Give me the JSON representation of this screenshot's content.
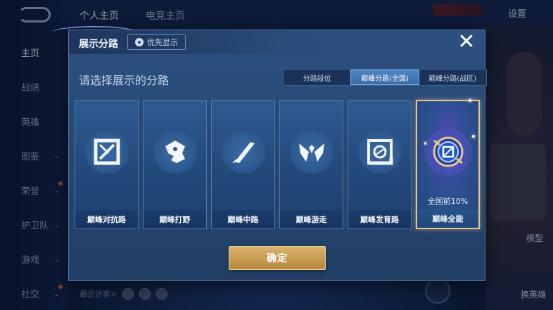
{
  "nav": {
    "items": [
      {
        "label": "主页",
        "active": true,
        "chevron": false,
        "dot": false
      },
      {
        "label": "战绩",
        "active": false,
        "chevron": false,
        "dot": false
      },
      {
        "label": "英雄",
        "active": false,
        "chevron": false,
        "dot": false
      },
      {
        "label": "图鉴",
        "active": false,
        "chevron": true,
        "dot": false
      },
      {
        "label": "荣誉",
        "active": false,
        "chevron": true,
        "dot": true
      },
      {
        "label": "护卫队",
        "active": false,
        "chevron": true,
        "dot": false
      },
      {
        "label": "游戏",
        "active": false,
        "chevron": true,
        "dot": false
      },
      {
        "label": "社交",
        "active": false,
        "chevron": true,
        "dot": true
      }
    ],
    "back_icon": "back-arrow-icon"
  },
  "top_tabs": [
    "个人主页",
    "电竞主页"
  ],
  "top_right": {
    "settings_label": "设置"
  },
  "right_panel": {
    "model_label": "模型",
    "switch_hero_label": "换英雄"
  },
  "bottom": {
    "visitors_label": "最近访客>"
  },
  "dialog": {
    "title": "展示分路",
    "priority_label": "优先显示",
    "subtitle": "请选择展示的分路",
    "close_icon": "close-icon",
    "segments": [
      {
        "label": "分路段位",
        "active": false
      },
      {
        "label": "巅峰分路(全国)",
        "active": true
      },
      {
        "label": "巅峰分路(战区)",
        "active": false
      }
    ],
    "cards": [
      {
        "label": "巅峰对抗路",
        "icon": "crossed-swords-icon",
        "selected": false,
        "rank": ""
      },
      {
        "label": "巅峰打野",
        "icon": "dragon-head-icon",
        "selected": false,
        "rank": ""
      },
      {
        "label": "巅峰中路",
        "icon": "staff-icon",
        "selected": false,
        "rank": ""
      },
      {
        "label": "巅峰游走",
        "icon": "winged-helmet-icon",
        "selected": false,
        "rank": ""
      },
      {
        "label": "巅峰发育路",
        "icon": "bow-target-icon",
        "selected": false,
        "rank": ""
      },
      {
        "label": "巅峰全能",
        "icon": "allround-emblem-icon",
        "selected": true,
        "rank": "全国前10%"
      }
    ],
    "confirm_label": "确定"
  },
  "colors": {
    "dialog_bg": "#2d5081",
    "card_bg": "#2e5b91",
    "selected_border": "#e8c38a",
    "confirm_gold": "#d9b26d",
    "active_segment": "#4f86c6"
  }
}
